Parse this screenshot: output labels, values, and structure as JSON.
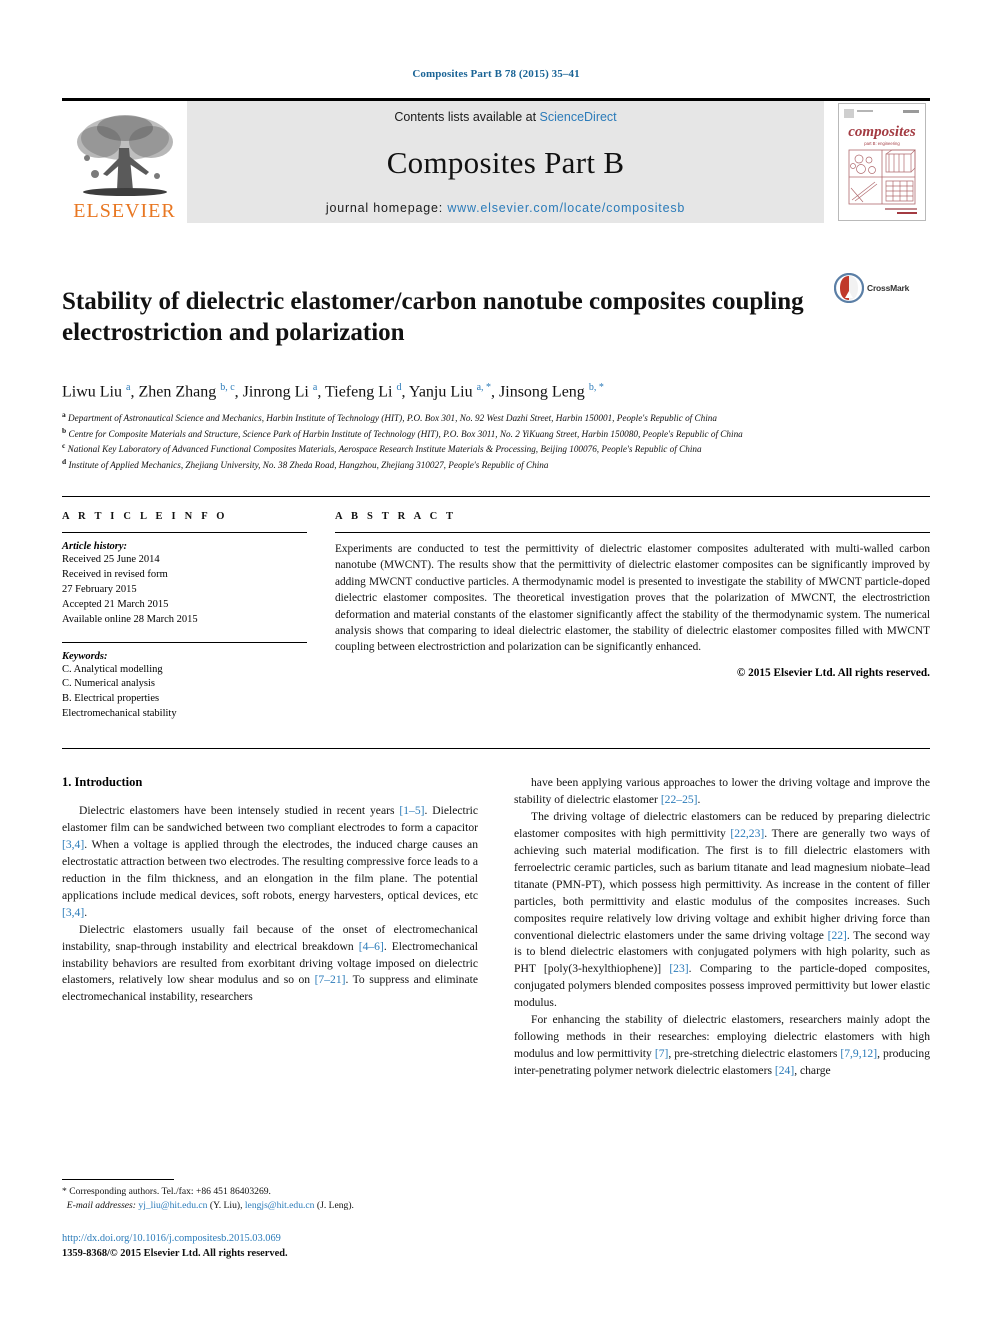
{
  "running_head": "Composites Part B 78 (2015) 35–41",
  "masthead": {
    "publisher_name": "ELSEVIER",
    "contents_prefix": "Contents lists available at",
    "contents_link": "ScienceDirect",
    "journal_title": "Composites Part B",
    "homepage_prefix": "journal homepage:",
    "homepage_url": "www.elsevier.com/locate/compositesb",
    "cover_word": "composites",
    "cover_subtitle": "part B: engineering",
    "link_color": "#2b7bb9"
  },
  "article": {
    "title": "Stability of dielectric elastomer/carbon nanotube composites coupling electrostriction and polarization",
    "crossmark_label": "CrossMark",
    "authors_html": "Liwu Liu <sup>a</sup>, Zhen Zhang <sup>b, c</sup>, Jinrong Li <sup>a</sup>, Tiefeng Li <sup>d</sup>, Yanju Liu <sup>a, <span class=\"star\">*</span></sup>, Jinsong Leng <sup>b, <span class=\"star\">*</span></sup>",
    "affiliations": [
      "a Department of Astronautical Science and Mechanics, Harbin Institute of Technology (HIT), P.O. Box 301, No. 92 West Dazhi Street, Harbin 150001, People's Republic of China",
      "b Centre for Composite Materials and Structure, Science Park of Harbin Institute of Technology (HIT), P.O. Box 3011, No. 2 YiKuang Street, Harbin 150080, People's Republic of China",
      "c National Key Laboratory of Advanced Functional Composites Materials, Aerospace Research Institute Materials & Processing, Beijing 100076, People's Republic of China",
      "d Institute of Applied Mechanics, Zhejiang University, No. 38 Zheda Road, Hangzhou, Zhejiang 310027, People's Republic of China"
    ]
  },
  "article_info": {
    "label": "A R T I C L E  I N F O",
    "history_heading": "Article history:",
    "history_lines": [
      "Received 25 June 2014",
      "Received in revised form",
      "27 February 2015",
      "Accepted 21 March 2015",
      "Available online 28 March 2015"
    ],
    "keywords_heading": "Keywords:",
    "keywords": [
      "C. Analytical modelling",
      "C. Numerical analysis",
      "B. Electrical properties",
      "Electromechanical stability"
    ]
  },
  "abstract": {
    "label": "A B S T R A C T",
    "text": "Experiments are conducted to test the permittivity of dielectric elastomer composites adulterated with multi-walled carbon nanotube (MWCNT). The results show that the permittivity of dielectric elastomer composites can be significantly improved by adding MWCNT conductive particles. A thermodynamic model is presented to investigate the stability of MWCNT particle-doped dielectric elastomer composites. The theoretical investigation proves that the polarization of MWCNT, the electrostriction deformation and material constants of the elastomer significantly affect the stability of the thermodynamic system. The numerical analysis shows that comparing to ideal dielectric elastomer, the stability of dielectric elastomer composites filled with MWCNT coupling between electrostriction and polarization can be significantly enhanced.",
    "copyright": "© 2015 Elsevier Ltd. All rights reserved."
  },
  "body": {
    "section_heading": "1. Introduction",
    "left_paragraphs": [
      "Dielectric elastomers have been intensely studied in recent years <span class=\"ref\">[1–5]</span>. Dielectric elastomer film can be sandwiched between two compliant electrodes to form a capacitor <span class=\"ref\">[3,4]</span>. When a voltage is applied through the electrodes, the induced charge causes an electrostatic attraction between two electrodes. The resulting compressive force leads to a reduction in the film thickness, and an elongation in the film plane. The potential applications include medical devices, soft robots, energy harvesters, optical devices, etc <span class=\"ref\">[3,4]</span>.",
      "Dielectric elastomers usually fail because of the onset of electromechanical instability, snap-through instability and electrical breakdown <span class=\"ref\">[4–6]</span>. Electromechanical instability behaviors are resulted from exorbitant driving voltage imposed on dielectric elastomers, relatively low shear modulus and so on <span class=\"ref\">[7–21]</span>. To suppress and eliminate electromechanical instability, researchers"
    ],
    "right_paragraphs": [
      "have been applying various approaches to lower the driving voltage and improve the stability of dielectric elastomer <span class=\"ref\">[22–25]</span>.",
      "The driving voltage of dielectric elastomers can be reduced by preparing dielectric elastomer composites with high permittivity <span class=\"ref\">[22,23]</span>. There are generally two ways of achieving such material modification. The first is to fill dielectric elastomers with ferroelectric ceramic particles, such as barium titanate and lead magnesium niobate–lead titanate (PMN-PT), which possess high permittivity. As increase in the content of filler particles, both permittivity and elastic modulus of the composites increases. Such composites require relatively low driving voltage and exhibit higher driving force than conventional dielectric elastomers under the same driving voltage <span class=\"ref\">[22]</span>. The second way is to blend dielectric elastomers with conjugated polymers with high polarity, such as PHT [poly(3-hexylthiophene)] <span class=\"ref\">[23]</span>. Comparing to the particle-doped composites, conjugated polymers blended composites possess improved permittivity but lower elastic modulus.",
      "For enhancing the stability of dielectric elastomers, researchers mainly adopt the following methods in their researches: employing dielectric elastomers with high modulus and low permittivity <span class=\"ref\">[7]</span>, pre-stretching dielectric elastomers <span class=\"ref\">[7,9,12]</span>, producing inter-penetrating polymer network dielectric elastomers <span class=\"ref\">[24]</span>, charge"
    ]
  },
  "footnote": {
    "corresponding": "* Corresponding authors. Tel./fax: +86 451 86403269.",
    "email_label": "E-mail addresses:",
    "email_1": "yj_liu@hit.edu.cn",
    "email_1_name": "(Y. Liu),",
    "email_2": "lengjs@hit.edu.cn",
    "email_2_name": "(J. Leng).",
    "doi": "http://dx.doi.org/10.1016/j.compositesb.2015.03.069",
    "issn": "1359-8368/© 2015 Elsevier Ltd. All rights reserved."
  }
}
